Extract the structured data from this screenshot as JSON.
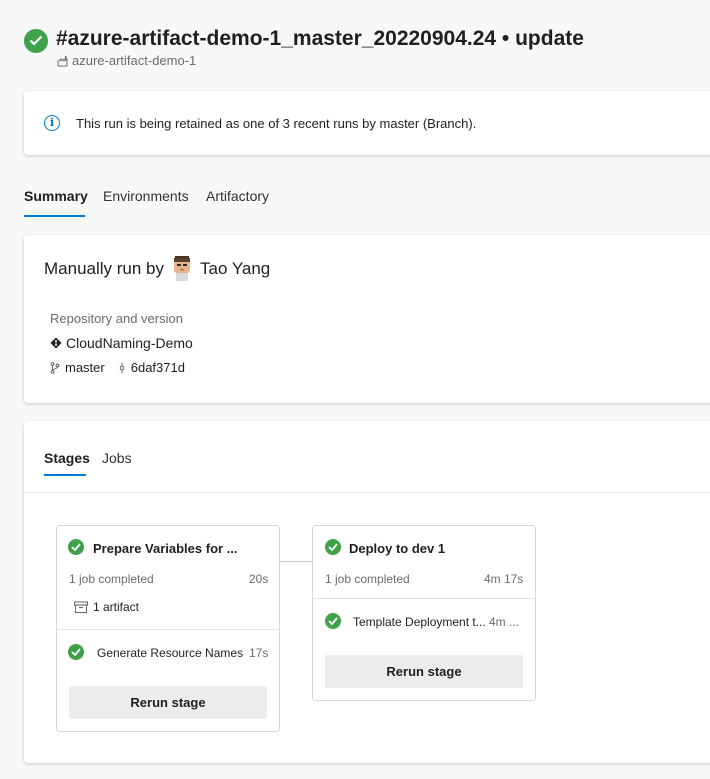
{
  "header": {
    "title": "#azure-artifact-demo-1_master_20220904.24 • update",
    "pipeline": "azure-artifact-demo-1"
  },
  "banner": {
    "text": "This run is being retained as one of 3 recent runs by master (Branch)."
  },
  "tabs": [
    "Summary",
    "Environments",
    "Artifactory"
  ],
  "summary": {
    "run_by_label": "Manually run by",
    "run_by_name": "Tao Yang",
    "repo_section_label": "Repository and version",
    "repository": "CloudNaming-Demo",
    "branch": "master",
    "commit": "6daf371d"
  },
  "stages_tabs": [
    "Stages",
    "Jobs"
  ],
  "stages": [
    {
      "title": "Prepare Variables for ...",
      "jobs_text": "1 job completed",
      "duration": "20s",
      "artifact_text": "1 artifact",
      "job_name": "Generate Resource Names",
      "job_duration": "17s",
      "rerun": "Rerun stage"
    },
    {
      "title": "Deploy to dev 1",
      "jobs_text": "1 job completed",
      "duration": "4m 17s",
      "job_name": "Template Deployment t...",
      "job_duration": "4m ...",
      "rerun": "Rerun stage"
    }
  ],
  "colors": {
    "success": "#3fa14a",
    "accent": "#0078d4"
  }
}
